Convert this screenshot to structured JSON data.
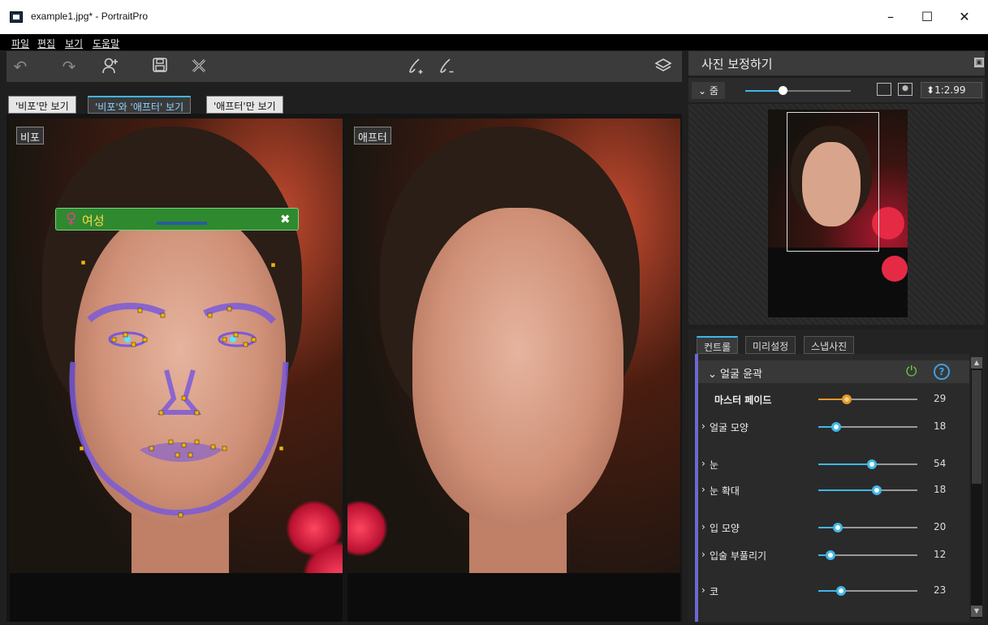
{
  "window": {
    "title": "example1.jpg* - PortraitPro",
    "minimize": "–",
    "maximize": "☐",
    "close": "✕"
  },
  "menu": [
    "파일",
    "편집",
    "보기",
    "도움말"
  ],
  "view_tabs": [
    "'비포'만 보기",
    "'비포'와 '애프터' 보기",
    "'애프터'만 보기"
  ],
  "active_view_tab": 1,
  "before_label": "비포",
  "after_label": "애프터",
  "gender": {
    "icon": "♀",
    "label": "여성",
    "close": "✖"
  },
  "right_panel": {
    "title": "사진 보정하기",
    "float_icon": "🗗",
    "zoom_label": "줌",
    "zoom_value": "1:2.99",
    "zoom_level": 0.35
  },
  "control_tabs": [
    "컨트롤",
    "미리설정",
    "스냅사진"
  ],
  "section_title": "얼굴 윤곽",
  "sliders": [
    {
      "label": "마스터 페이드",
      "value": "29",
      "pos": 0.29,
      "master": true
    },
    {
      "label": "얼굴 모양",
      "value": "18",
      "pos": 0.18
    },
    {
      "label": "눈",
      "value": "54",
      "pos": 0.54
    },
    {
      "label": "눈 확대",
      "value": "18",
      "pos": 0.59
    },
    {
      "label": "입 모양",
      "value": "20",
      "pos": 0.2
    },
    {
      "label": "입술 부풀리기",
      "value": "12",
      "pos": 0.12
    },
    {
      "label": "코",
      "value": "23",
      "pos": 0.23
    }
  ],
  "colors": {
    "accent": "#3fb7e8",
    "master": "#e09a28",
    "power": "#6bd53a"
  }
}
